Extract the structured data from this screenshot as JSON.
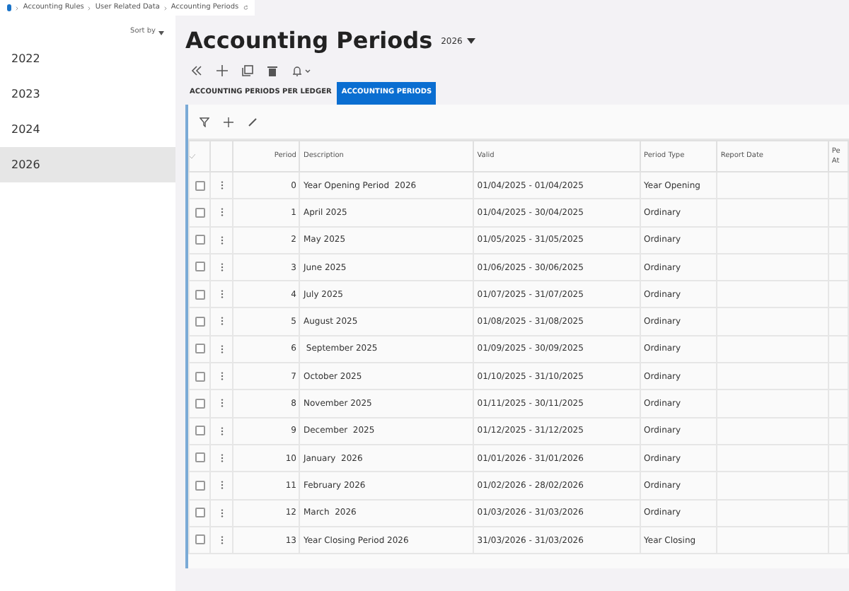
{
  "breadcrumb": [
    "Accounting Rules",
    "User Related Data",
    "Accounting Periods"
  ],
  "sidebar": {
    "sort_label": "Sort by",
    "items": [
      {
        "label": "2022",
        "selected": false
      },
      {
        "label": "2023",
        "selected": false
      },
      {
        "label": "2024",
        "selected": false
      },
      {
        "label": "2026",
        "selected": true
      }
    ]
  },
  "title": "Accounting Periods",
  "year_selector": "2026",
  "tabs": [
    {
      "label": "ACCOUNTING PERIODS PER LEDGER",
      "selected": false
    },
    {
      "label": "ACCOUNTING PERIODS",
      "selected": true
    }
  ],
  "table": {
    "columns": [
      "Period",
      "Description",
      "Valid",
      "Period Type",
      "Report Date",
      "Pe At"
    ],
    "rows": [
      {
        "checked": false,
        "cells": [
          "0",
          "Year Opening Period  2026",
          "01/04/2025 - 01/04/2025",
          "Year Opening",
          ""
        ]
      },
      {
        "checked": false,
        "cells": [
          "1",
          "April 2025",
          "01/04/2025 - 30/04/2025",
          "Ordinary",
          ""
        ]
      },
      {
        "checked": false,
        "cells": [
          "2",
          "May 2025",
          "01/05/2025 - 31/05/2025",
          "Ordinary",
          ""
        ]
      },
      {
        "checked": false,
        "cells": [
          "3",
          "June 2025",
          "01/06/2025 - 30/06/2025",
          "Ordinary",
          ""
        ]
      },
      {
        "checked": false,
        "cells": [
          "4",
          "July 2025",
          "01/07/2025 - 31/07/2025",
          "Ordinary",
          ""
        ]
      },
      {
        "checked": false,
        "cells": [
          "5",
          "August 2025",
          "01/08/2025 - 31/08/2025",
          "Ordinary",
          ""
        ]
      },
      {
        "checked": false,
        "cells": [
          "6",
          " September 2025",
          "01/09/2025 - 30/09/2025",
          "Ordinary",
          ""
        ]
      },
      {
        "checked": false,
        "cells": [
          "7",
          "October 2025",
          "01/10/2025 - 31/10/2025",
          "Ordinary",
          ""
        ]
      },
      {
        "checked": false,
        "cells": [
          "8",
          "November 2025",
          "01/11/2025 - 30/11/2025",
          "Ordinary",
          ""
        ]
      },
      {
        "checked": false,
        "cells": [
          "9",
          "December  2025",
          "01/12/2025 - 31/12/2025",
          "Ordinary",
          ""
        ]
      },
      {
        "checked": false,
        "cells": [
          "10",
          "January  2026",
          "01/01/2026 - 31/01/2026",
          "Ordinary",
          ""
        ]
      },
      {
        "checked": false,
        "cells": [
          "11",
          "February 2026",
          "01/02/2026 - 28/02/2026",
          "Ordinary",
          ""
        ]
      },
      {
        "checked": false,
        "cells": [
          "12",
          "March  2026",
          "01/03/2026 - 31/03/2026",
          "Ordinary",
          ""
        ]
      },
      {
        "checked": false,
        "cells": [
          "13",
          "Year Closing Period 2026",
          "31/03/2026 - 31/03/2026",
          "Year Closing",
          ""
        ]
      }
    ]
  }
}
